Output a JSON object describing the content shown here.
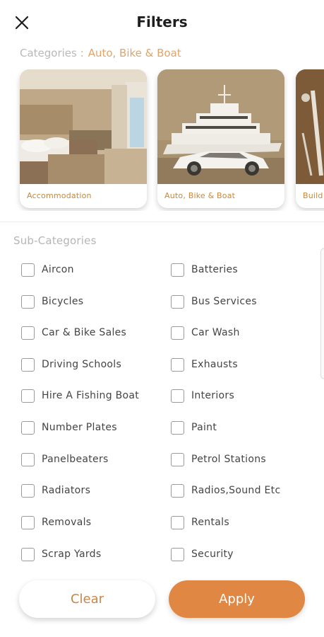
{
  "header": {
    "title": "Filters",
    "close_icon": "close-icon"
  },
  "categories": {
    "label": "Categories :",
    "selected": "Auto,  Bike & Boat"
  },
  "cards": [
    {
      "caption": "Accommodation",
      "image": "bedroom-photo"
    },
    {
      "caption": "Auto,  Bike & Boat",
      "image": "yacht-and-car-photo"
    },
    {
      "caption": "Build",
      "image": "tools-photo"
    }
  ],
  "subcategories": {
    "title": "Sub-Categories",
    "left": [
      "Aircon",
      "Bicycles",
      "Car & Bike Sales",
      "Driving Schools",
      "Hire A Fishing Boat",
      "Number Plates",
      "Panelbeaters",
      "Radiators",
      "Removals",
      "Scrap Yards"
    ],
    "right": [
      "Batteries",
      "Bus Services",
      "Car Wash",
      "Exhausts",
      "Interiors",
      "Paint",
      "Petrol Stations",
      "Radios,Sound Etc",
      "Rentals",
      "Security"
    ]
  },
  "footer": {
    "clear_label": "Clear",
    "apply_label": "Apply"
  },
  "colors": {
    "accent": "#e08843",
    "accent_text": "#c9854a",
    "category_value": "#e0a46a"
  }
}
